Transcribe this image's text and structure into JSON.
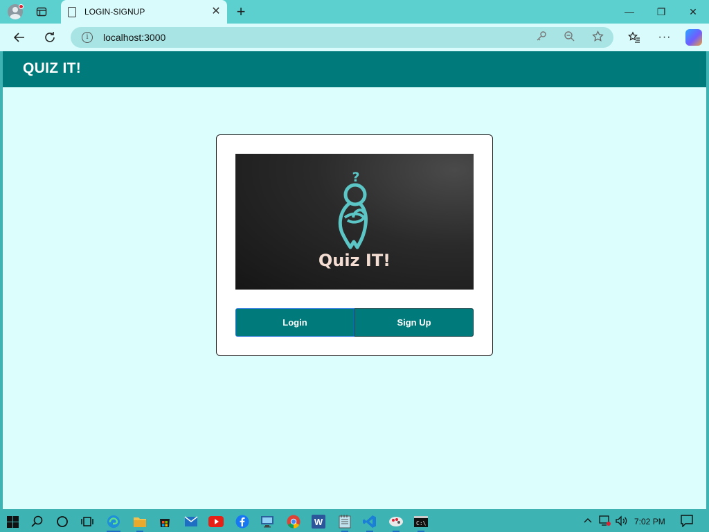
{
  "browser": {
    "tab_title": "LOGIN-SIGNUP",
    "url": "localhost:3000",
    "new_tab_symbol": "+",
    "close_tab_symbol": "✕",
    "window_controls": {
      "minimize": "—",
      "restore": "❐",
      "close": "✕"
    }
  },
  "app": {
    "header_title": "QUIZ IT!",
    "logo_text": "Quiz IT!",
    "logo_question_mark": "?",
    "login_label": "Login",
    "signup_label": "Sign Up"
  },
  "taskbar": {
    "time": "7:02 PM",
    "apps": [
      "start-icon",
      "search-icon",
      "cortana-icon",
      "task-view-icon",
      "edge-icon",
      "file-explorer-icon",
      "store-icon",
      "mail-icon",
      "youtube-icon",
      "facebook-icon",
      "remote-desktop-icon",
      "chrome-icon",
      "word-icon",
      "notepad-icon",
      "vscode-icon",
      "paint-icon",
      "terminal-icon"
    ]
  },
  "colors": {
    "header_bg": "#007a7a",
    "page_bg": "#dcfffe",
    "button_bg": "#007a7a",
    "logo_accent": "#5cc6c6"
  }
}
